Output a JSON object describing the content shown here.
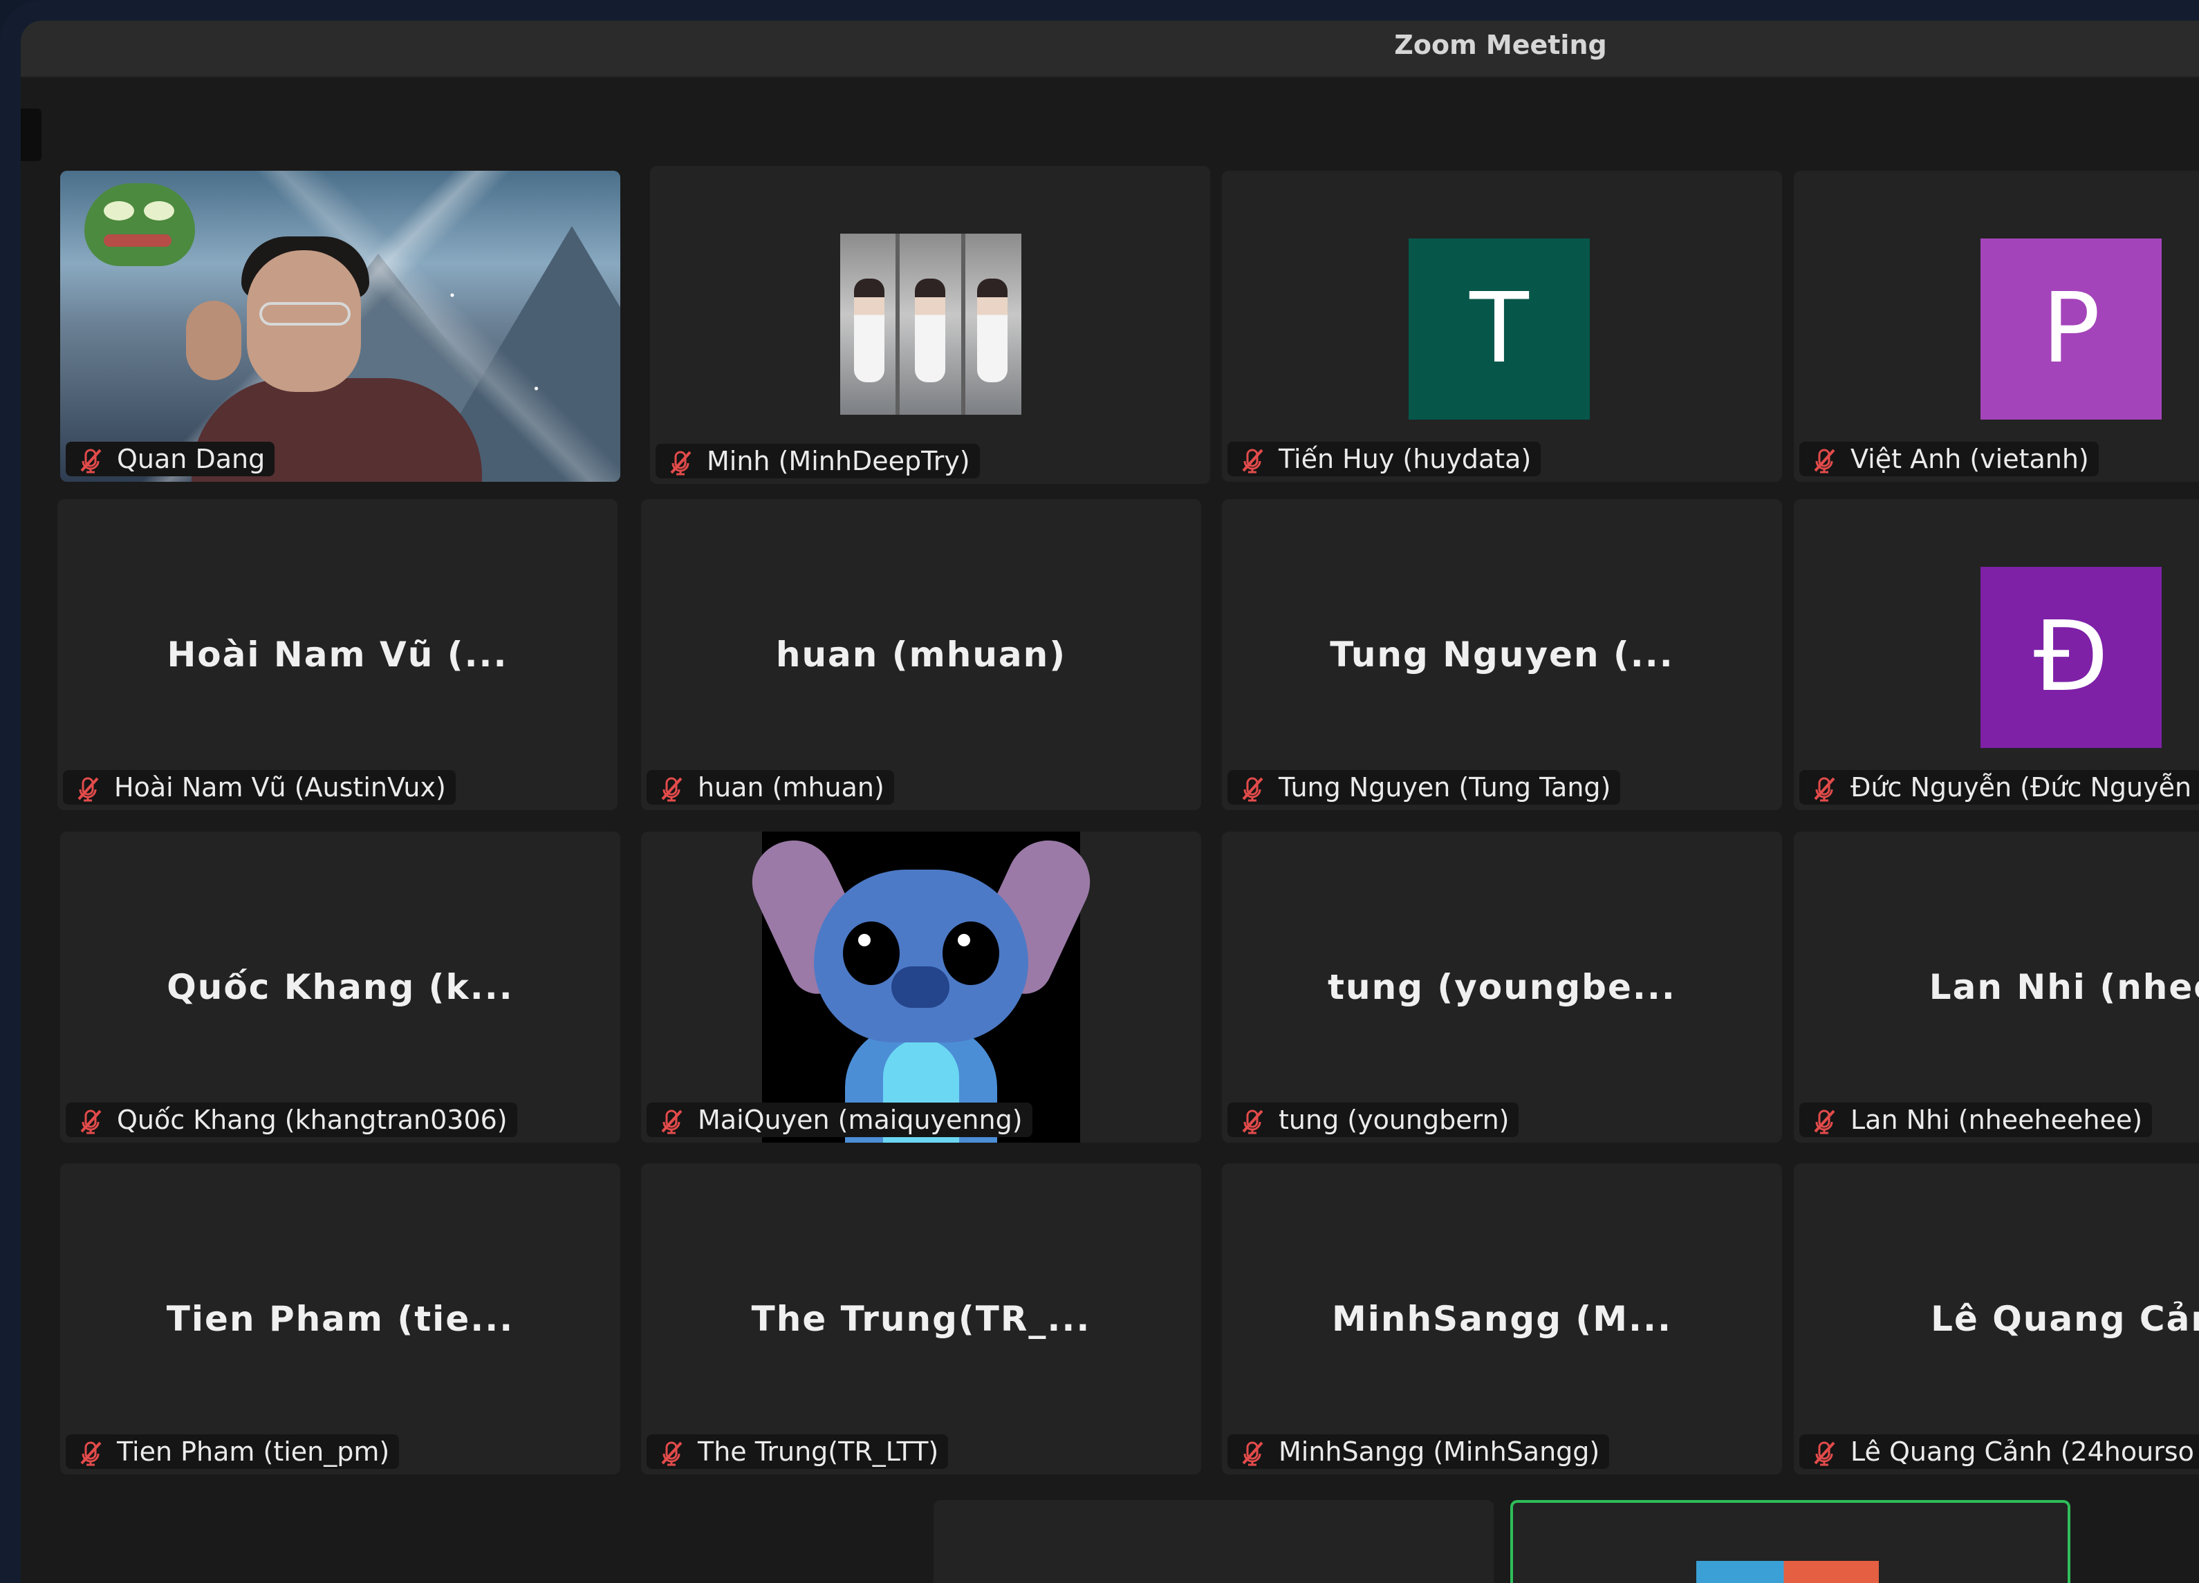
{
  "window": {
    "title": "Zoom Meeting"
  },
  "meeting": {
    "participants": [
      {
        "name": "Quan Dang",
        "label": "Quan Dang",
        "muted": true,
        "tile_type": "video"
      },
      {
        "name": "Minh (MinhDeepTry)",
        "label": "Minh (MinhDeepTry)",
        "muted": true,
        "tile_type": "photo"
      },
      {
        "name": "Tiến Huy (huydata)",
        "label": "Tiến Huy (huydata)",
        "muted": true,
        "tile_type": "avatar",
        "avatar_letter": "T",
        "avatar_color": "#06574a"
      },
      {
        "name": "Việt Anh (vietanh)",
        "label": "Việt Anh (vietanh)",
        "muted": true,
        "tile_type": "avatar",
        "avatar_letter": "P",
        "avatar_color": "#a444ba"
      },
      {
        "name": "Hoài Nam Vũ (...",
        "label": "Hoài Nam Vũ (AustinVux)",
        "muted": true,
        "tile_type": "name"
      },
      {
        "name": "huan (mhuan)",
        "label": "huan (mhuan)",
        "muted": true,
        "tile_type": "name"
      },
      {
        "name": "Tung Nguyen (...",
        "label": "Tung Nguyen (Tung Tang)",
        "muted": true,
        "tile_type": "name"
      },
      {
        "name": "Đức Nguyễn (Đức Nguyễn",
        "label": "Đức Nguyễn (Đức Nguyễn",
        "muted": true,
        "tile_type": "avatar",
        "avatar_letter": "Đ",
        "avatar_color": "#7e21a7"
      },
      {
        "name": "Quốc Khang (k...",
        "label": "Quốc Khang (khangtran0306)",
        "muted": true,
        "tile_type": "name"
      },
      {
        "name": "MaiQuyen (maiquyenng)",
        "label": "MaiQuyen (maiquyenng)",
        "muted": true,
        "tile_type": "stitch"
      },
      {
        "name": "tung (youngbe...",
        "label": "tung (youngbern)",
        "muted": true,
        "tile_type": "name"
      },
      {
        "name": "Lan Nhi (nhee",
        "label": "Lan Nhi (nheeheehee)",
        "muted": true,
        "tile_type": "name"
      },
      {
        "name": "Tien Pham (tie...",
        "label": "Tien Pham (tien_pm)",
        "muted": true,
        "tile_type": "name"
      },
      {
        "name": "The Trung(TR_...",
        "label": "The Trung(TR_LTT)",
        "muted": true,
        "tile_type": "name"
      },
      {
        "name": "MinhSangg (M...",
        "label": "MinhSangg (MinhSangg)",
        "muted": true,
        "tile_type": "name"
      },
      {
        "name": "Lê Quang Cản",
        "label": "Lê Quang Cảnh (24hourso",
        "muted": true,
        "tile_type": "name"
      }
    ]
  },
  "colors": {
    "active_speaker_border": "#2fbd5a",
    "muted_icon": "#e34b4b"
  },
  "icons": {
    "muted": "microphone-muted-icon"
  }
}
